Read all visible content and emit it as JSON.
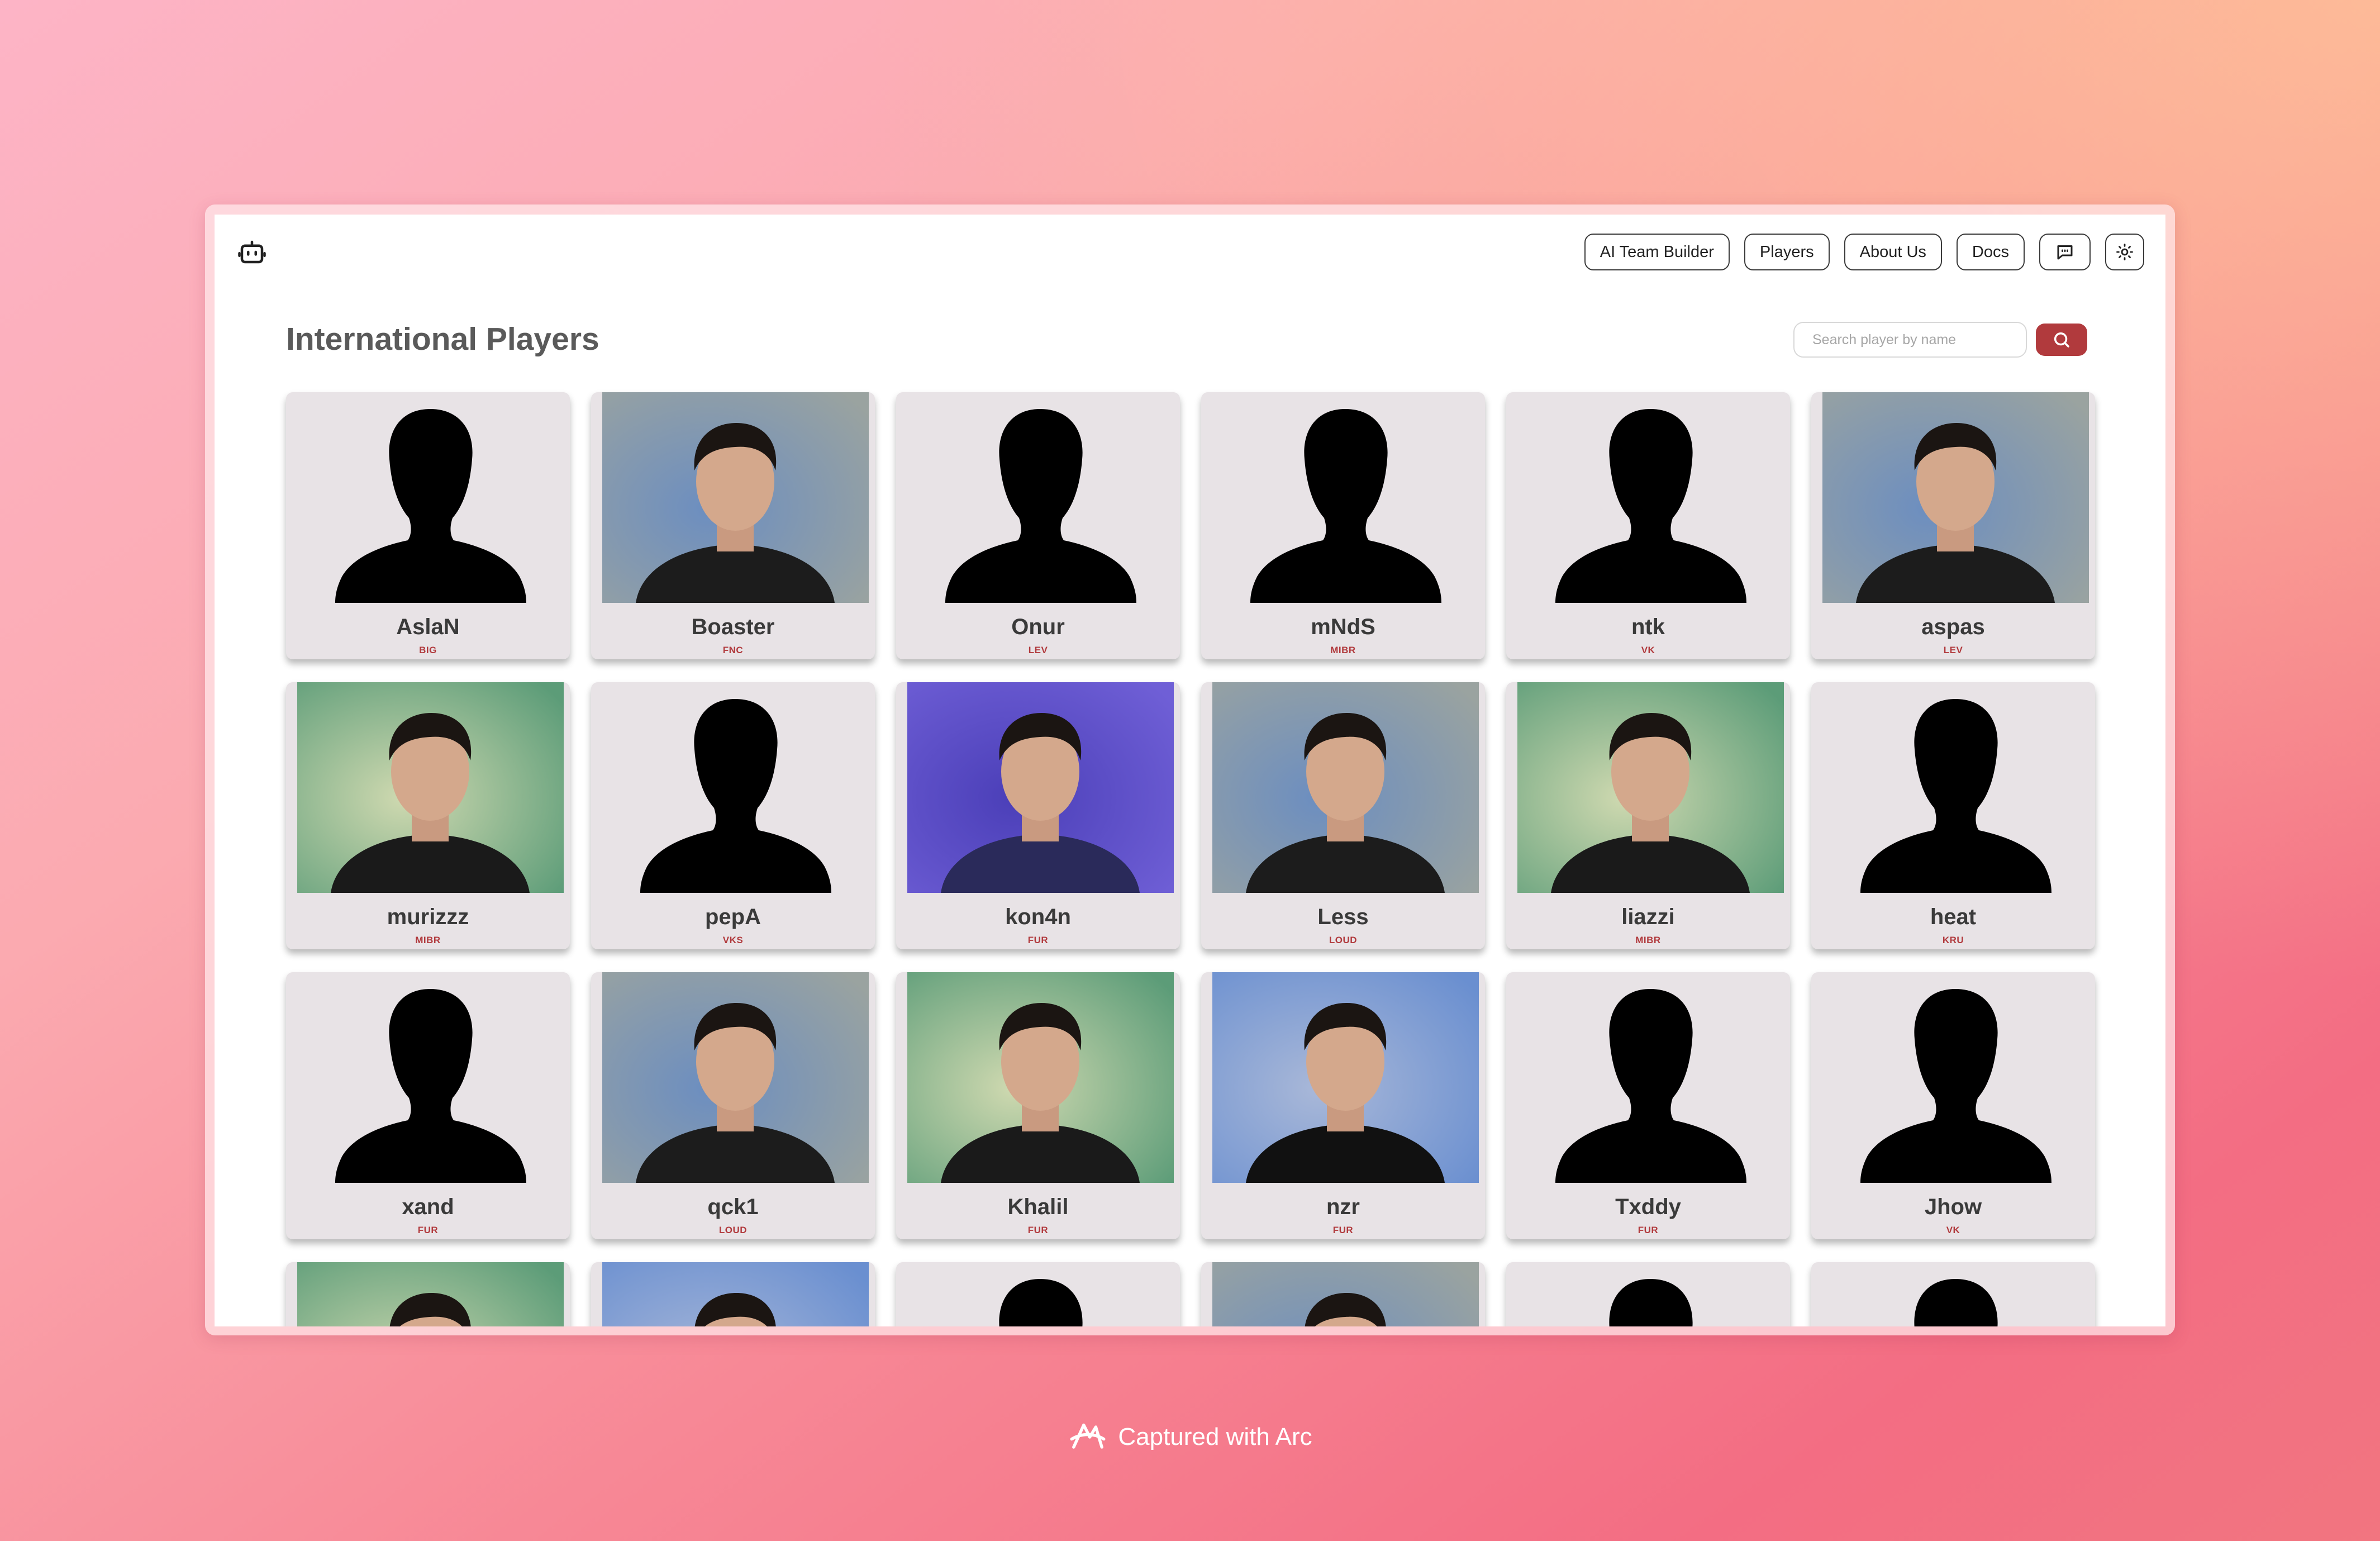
{
  "nav": {
    "ai_team_builder": "AI Team Builder",
    "players": "Players",
    "about_us": "About Us",
    "docs": "Docs"
  },
  "page": {
    "title": "International Players"
  },
  "search": {
    "placeholder": "Search player by name"
  },
  "players": [
    {
      "name": "AslaN",
      "team": "BIG",
      "photo": "silhouette"
    },
    {
      "name": "Boaster",
      "team": "FNC",
      "photo": "person"
    },
    {
      "name": "Onur",
      "team": "LEV",
      "photo": "silhouette"
    },
    {
      "name": "mNdS",
      "team": "MIBR",
      "photo": "silhouette"
    },
    {
      "name": "ntk",
      "team": "VK",
      "photo": "silhouette"
    },
    {
      "name": "aspas",
      "team": "LEV",
      "photo": "person"
    },
    {
      "name": "murizzz",
      "team": "MIBR",
      "photo": "person"
    },
    {
      "name": "pepA",
      "team": "VKS",
      "photo": "silhouette"
    },
    {
      "name": "kon4n",
      "team": "FUR",
      "photo": "person"
    },
    {
      "name": "Less",
      "team": "LOUD",
      "photo": "person"
    },
    {
      "name": "liazzi",
      "team": "MIBR",
      "photo": "person"
    },
    {
      "name": "heat",
      "team": "KRU",
      "photo": "silhouette"
    },
    {
      "name": "xand",
      "team": "FUR",
      "photo": "silhouette"
    },
    {
      "name": "qck1",
      "team": "LOUD",
      "photo": "person"
    },
    {
      "name": "Khalil",
      "team": "FUR",
      "photo": "person"
    },
    {
      "name": "nzr",
      "team": "FUR",
      "photo": "person"
    },
    {
      "name": "Txddy",
      "team": "FUR",
      "photo": "silhouette"
    },
    {
      "name": "Jhow",
      "team": "VK",
      "photo": "silhouette"
    },
    {
      "name": "",
      "team": "",
      "photo": "person"
    },
    {
      "name": "",
      "team": "",
      "photo": "person"
    },
    {
      "name": "",
      "team": "",
      "photo": "silhouette"
    },
    {
      "name": "",
      "team": "",
      "photo": "person"
    },
    {
      "name": "",
      "team": "",
      "photo": "silhouette"
    },
    {
      "name": "",
      "team": "",
      "photo": "silhouette"
    }
  ],
  "footer": {
    "text": "Captured with Arc"
  },
  "icons": {
    "logo": "robot-icon",
    "chat": "chat-bubble-icon",
    "theme": "sun-icon",
    "search": "search-icon",
    "footer": "arc-logo-icon"
  },
  "colors": {
    "accent": "#b13a3d",
    "card_bg": "#e8e3e6"
  }
}
